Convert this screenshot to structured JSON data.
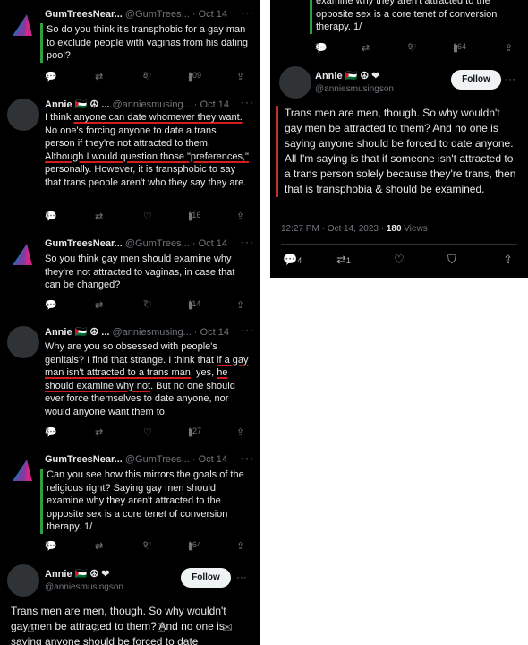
{
  "left": {
    "tweets": [
      {
        "name": "GumTreesNear...",
        "handle": "@GumTrees...",
        "date": "Oct 14",
        "text": "So do you think it's transphobic for a gay man to exclude people with vaginas from his dating pool?",
        "counts": {
          "reply": "1",
          "retweet": "",
          "like": "8",
          "views": "109"
        }
      },
      {
        "name": "Annie 🇵🇸 ☮ ...",
        "handle": "@anniesmusing...",
        "date": "Oct 14",
        "text_parts": [
          "I think ",
          "anyone can date whomever they want.",
          " No one's forcing anyone to date a trans person if they're not attracted to them. ",
          "Although I would question those \"preferences,\"",
          " personally. However, it is transphobic to say that trans people aren't who they say they are."
        ],
        "counts": {
          "reply": "3",
          "retweet": "",
          "like": "",
          "views": "116"
        }
      },
      {
        "name": "GumTreesNear...",
        "handle": "@GumTrees...",
        "date": "Oct 14",
        "text": "So you think gay men should examine why they're not attracted to vaginas, in case that can be changed?",
        "counts": {
          "reply": "1",
          "retweet": "",
          "like": "7",
          "views": "114"
        }
      },
      {
        "name": "Annie 🇵🇸 ☮ ...",
        "handle": "@anniesmusing...",
        "date": "Oct 14",
        "text_parts": [
          "Why are you so obsessed with people's genitals?  I find that strange. I think that ",
          "if a gay man isn't attracted to a trans man",
          ", yes, ",
          "he should examine why not",
          ". But no one should ever force themselves to date anyone, nor would anyone want them to."
        ],
        "counts": {
          "reply": "3",
          "retweet": "",
          "like": "",
          "views": "127"
        }
      },
      {
        "name": "GumTreesNear...",
        "handle": "@GumTrees...",
        "date": "Oct 14",
        "text": "Can you see how this mirrors the goals of the religious right? Saying gay men should examine why they aren't attracted to the opposite sex is a core tenet of conversion therapy. 1/",
        "counts": {
          "reply": "2",
          "retweet": "",
          "like": "9",
          "views": "164"
        }
      }
    ],
    "main": {
      "name": "Annie 🇵🇸 ☮ ❤",
      "handle": "@anniesmusingson",
      "follow": "Follow",
      "text": "Trans men are men, though. So why wouldn't gay men be attracted to them? And no one is saying anyone should be forced to date"
    }
  },
  "right": {
    "top_text": "examine why they aren't attracted to the opposite sex is a core tenet of conversion therapy. 1/",
    "top_counts": {
      "reply": "2",
      "retweet": "",
      "like": "9",
      "views": "164"
    },
    "main": {
      "name": "Annie 🇵🇸 ☮ ❤",
      "handle": "@anniesmusingson",
      "follow": "Follow",
      "text": "Trans men are men, though. So why wouldn't gay men be attracted to them? And no one is saying anyone should be forced to date anyone. All I'm saying is that if someone isn't attracted to a trans person solely because they're trans, then that is transphobia & should be examined.",
      "time": "12:27 PM · Oct 14, 2023 · ",
      "views_count": "180",
      "views_label": " Views",
      "counts": {
        "reply": "4",
        "retweet": "1"
      }
    }
  },
  "icons": {
    "reply": "reply-icon",
    "retweet": "retweet-icon",
    "like": "heart-icon",
    "views": "views-icon",
    "share": "share-icon",
    "bookmark": "bookmark-icon"
  },
  "colors": {
    "bg": "#000000",
    "text": "#e7e9ea",
    "muted": "#71767b",
    "green_bar": "#2ea043",
    "red_underline": "#d31c1c"
  }
}
